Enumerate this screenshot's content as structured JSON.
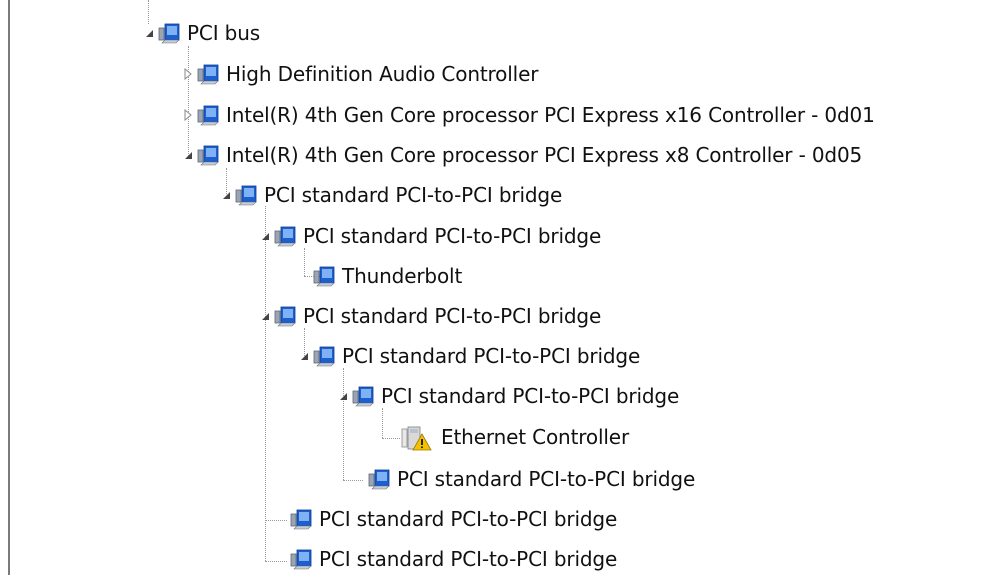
{
  "tree": {
    "nodes": [
      {
        "label": "PCI bus",
        "icon": "pci-device-icon",
        "state": "expanded"
      },
      {
        "label": "High Definition Audio Controller",
        "icon": "pci-device-icon",
        "state": "collapsed"
      },
      {
        "label": "Intel(R) 4th Gen Core processor PCI Express x16 Controller - 0d01",
        "icon": "pci-device-icon",
        "state": "collapsed"
      },
      {
        "label": "Intel(R) 4th Gen Core processor PCI Express x8 Controller - 0d05",
        "icon": "pci-device-icon",
        "state": "expanded"
      },
      {
        "label": "PCI standard PCI-to-PCI bridge",
        "icon": "pci-device-icon",
        "state": "expanded"
      },
      {
        "label": "PCI standard PCI-to-PCI bridge",
        "icon": "pci-device-icon",
        "state": "expanded"
      },
      {
        "label": "Thunderbolt",
        "icon": "pci-device-icon",
        "state": "leaf"
      },
      {
        "label": "PCI standard PCI-to-PCI bridge",
        "icon": "pci-device-icon",
        "state": "expanded"
      },
      {
        "label": "PCI standard PCI-to-PCI bridge",
        "icon": "pci-device-icon",
        "state": "expanded"
      },
      {
        "label": "PCI standard PCI-to-PCI bridge",
        "icon": "pci-device-icon",
        "state": "expanded"
      },
      {
        "label": "Ethernet Controller",
        "icon": "unknown-device-warning-icon",
        "state": "leaf"
      },
      {
        "label": "PCI standard PCI-to-PCI bridge",
        "icon": "pci-device-icon",
        "state": "leaf"
      },
      {
        "label": "PCI standard PCI-to-PCI bridge",
        "icon": "pci-device-icon",
        "state": "leaf"
      },
      {
        "label": "PCI standard PCI-to-PCI bridge",
        "icon": "pci-device-icon",
        "state": "leaf"
      }
    ]
  },
  "colors": {
    "text": "#111111",
    "tree_line": "#9a9a9a",
    "warning": "#f2c200",
    "device_blue": "#1d5fd1"
  }
}
